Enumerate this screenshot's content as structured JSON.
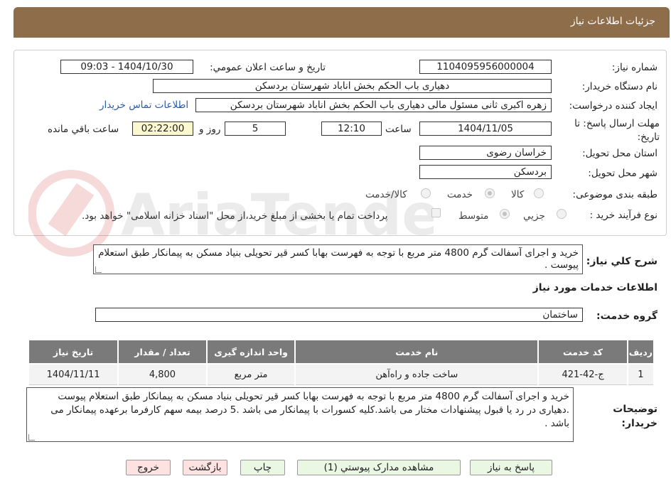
{
  "header": {
    "title": "جزئيات اطلاعات نياز"
  },
  "form": {
    "need_number_label": "شماره نياز:",
    "need_number": "1104095956000004",
    "announce_label": "تاريخ و ساعت اعلان عمومي:",
    "announce_value": "1404/10/30 - 09:03",
    "buyer_org_label": "نام دستگاه خريدار:",
    "buyer_org": "دهیاری باب الحکم بخش اناباد شهرستان بردسکن",
    "requester_label": "ايجاد کننده درخواست:",
    "requester": "زهره اکبری ثانی مسئول مالی دهیاری باب الحکم بخش اناباد شهرستان بردسکن",
    "contact_link": "اطلاعات تماس خريدار",
    "deadline_label": "مهلت ارسال پاسخ: تا تاريخ:",
    "deadline_date": "1404/11/05",
    "time_label": "ساعت",
    "deadline_time": "12:10",
    "days_value": "5",
    "days_label": "روز و",
    "remaining_time": "02:22:00",
    "remaining_label": "ساعت باقي مانده",
    "province_label": "استان محل تحويل:",
    "province": "خراسان رضوی",
    "city_label": "شهر محل تحويل:",
    "city": "بردسکن",
    "category_label": "طبقه بندی موضوعی:",
    "category_options": [
      "کالا",
      "خدمت",
      "کالا/خدمت"
    ],
    "process_label": "نوع فرآيند خريد :",
    "process_options": [
      "جزيي",
      "متوسط"
    ],
    "payment_note": "پرداخت تمام يا بخشی از مبلغ خريد،از محل \"اسناد خزانه اسلامی\" خواهد بود."
  },
  "summary": {
    "label": "شرح کلي نياز:",
    "text": "خرید و اجرای آسفالت گرم  4800 متر مربع با توجه به فهرست بهابا کسر قیر تحویلی بنیاد مسکن به پیمانکار طبق استعلام پیوست ."
  },
  "services": {
    "title": "اطلاعات خدمات مورد نياز",
    "group_label": "گروه خدمت:",
    "group_value": "ساختمان",
    "columns": [
      "رديف",
      "کد خدمت",
      "نام خدمت",
      "واحد اندازه گيری",
      "تعداد / مقدار",
      "تاريخ نياز"
    ],
    "rows": [
      [
        "1",
        "ج-42-421",
        "ساخت جاده و راه‌آهن",
        "متر مربع",
        "4,800",
        "1404/11/11"
      ]
    ]
  },
  "buyer_notes": {
    "label": "توضيحات خريدار:",
    "text": "خرید و اجرای آسفالت گرم  4800 متر مربع با توجه به فهرست بهابا کسر قیر تحویلی بنیاد مسکن به پیمانکار طبق استعلام پیوست .دهیاری در رد یا قبول پیشنهادات مختار می باشد.کلیه کسورات با پیمانکار می باشد .5 درصد بیمه سهم کارفرما برعهده پیمانکار می باشد ."
  },
  "buttons": {
    "reply": "پاسخ به نياز",
    "attachments": "مشاهده مدارک پيوستي (1)",
    "print": "چاپ",
    "back": "بازگشت",
    "exit": "خروج"
  }
}
